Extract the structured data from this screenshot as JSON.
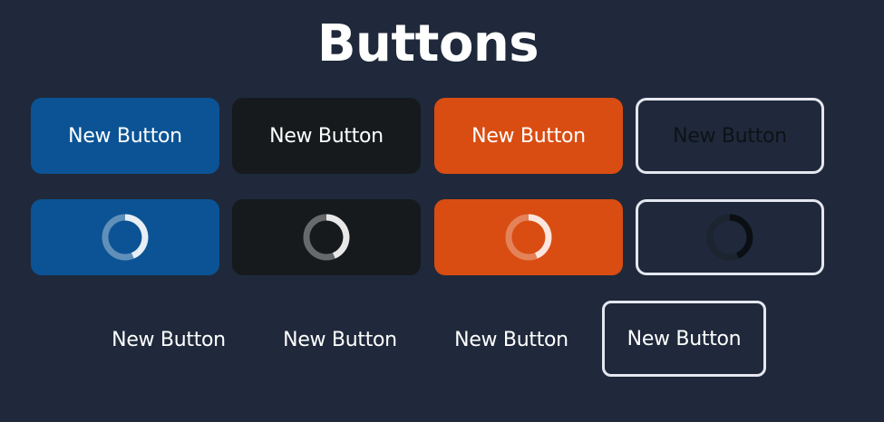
{
  "page": {
    "title": "Buttons"
  },
  "colors": {
    "background": "#1f293b",
    "primary_blue": "#0b5394",
    "dark": "#161a1d",
    "accent_orange": "#d94d12",
    "outline_border": "#e5e7ef"
  },
  "filled_buttons": [
    {
      "label": "New Button",
      "variant": "blue"
    },
    {
      "label": "New Button",
      "variant": "black"
    },
    {
      "label": "New Button",
      "variant": "orange"
    },
    {
      "label": "New Button",
      "variant": "outline"
    }
  ],
  "loading_buttons": [
    {
      "variant": "blue",
      "icon": "loading-spinner-icon"
    },
    {
      "variant": "black",
      "icon": "loading-spinner-icon"
    },
    {
      "variant": "orange",
      "icon": "loading-spinner-icon"
    },
    {
      "variant": "outline",
      "icon": "loading-spinner-icon"
    }
  ],
  "text_buttons": [
    {
      "label": "New Button",
      "variant": "text"
    },
    {
      "label": "New Button",
      "variant": "text"
    },
    {
      "label": "New Button",
      "variant": "text"
    },
    {
      "label": "New Button",
      "variant": "outlined-text"
    }
  ]
}
